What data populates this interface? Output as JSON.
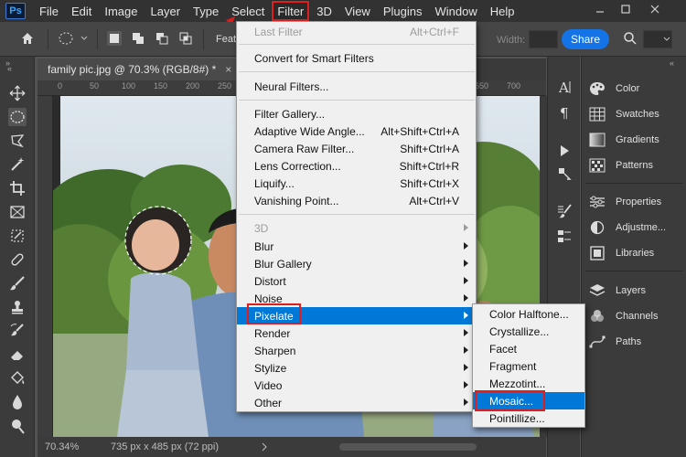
{
  "app": {
    "logo": "Ps"
  },
  "menubar": {
    "items": [
      "File",
      "Edit",
      "Image",
      "Layer",
      "Type",
      "Select",
      "Filter",
      "3D",
      "View",
      "Plugins",
      "Window",
      "Help"
    ],
    "active": "Filter",
    "window_controls": [
      "minimize-icon",
      "restore-icon",
      "close-icon"
    ]
  },
  "options_bar": {
    "feather_label": "Feath",
    "width_label": "Width:",
    "share_label": "Share",
    "icons": [
      "home-icon",
      "ellipse-marquee-icon",
      "new-selection-icon",
      "add-selection-icon",
      "subtract-selection-icon",
      "intersect-selection-icon",
      "search-icon"
    ]
  },
  "document": {
    "tab_title": "family pic.jpg @ 70.3% (RGB/8#) *",
    "close_label": "×",
    "ruler_ticks": [
      "0",
      "50",
      "100",
      "150",
      "200",
      "250",
      "300",
      "350",
      "400",
      "450",
      "500",
      "550",
      "600",
      "650",
      "700"
    ],
    "zoom": "70.34%",
    "doc_info": "735 px x 485 px (72 ppi)"
  },
  "filter_menu": {
    "items": [
      {
        "label": "Last Filter",
        "shortcut": "Alt+Ctrl+F",
        "disabled": true
      },
      {
        "label": "Convert for Smart Filters"
      },
      {
        "label": "Neural Filters..."
      },
      {
        "label": "Filter Gallery..."
      },
      {
        "label": "Adaptive Wide Angle...",
        "shortcut": "Alt+Shift+Ctrl+A"
      },
      {
        "label": "Camera Raw Filter...",
        "shortcut": "Shift+Ctrl+A"
      },
      {
        "label": "Lens Correction...",
        "shortcut": "Shift+Ctrl+R"
      },
      {
        "label": "Liquify...",
        "shortcut": "Shift+Ctrl+X"
      },
      {
        "label": "Vanishing Point...",
        "shortcut": "Alt+Ctrl+V"
      },
      {
        "label": "3D",
        "submenu": true,
        "disabled": true
      },
      {
        "label": "Blur",
        "submenu": true
      },
      {
        "label": "Blur Gallery",
        "submenu": true
      },
      {
        "label": "Distort",
        "submenu": true
      },
      {
        "label": "Noise",
        "submenu": true
      },
      {
        "label": "Pixelate",
        "submenu": true,
        "highlighted": true
      },
      {
        "label": "Render",
        "submenu": true
      },
      {
        "label": "Sharpen",
        "submenu": true
      },
      {
        "label": "Stylize",
        "submenu": true
      },
      {
        "label": "Video",
        "submenu": true
      },
      {
        "label": "Other",
        "submenu": true
      }
    ]
  },
  "pixelate_submenu": {
    "items": [
      {
        "label": "Color Halftone..."
      },
      {
        "label": "Crystallize..."
      },
      {
        "label": "Facet"
      },
      {
        "label": "Fragment"
      },
      {
        "label": "Mezzotint..."
      },
      {
        "label": "Mosaic...",
        "highlighted": true
      },
      {
        "label": "Pointillize..."
      }
    ]
  },
  "right_panels": {
    "group1": [
      {
        "label": "Color",
        "icon": "palette-icon"
      },
      {
        "label": "Swatches",
        "icon": "swatches-icon"
      },
      {
        "label": "Gradients",
        "icon": "gradient-icon"
      },
      {
        "label": "Patterns",
        "icon": "patterns-icon"
      }
    ],
    "group2": [
      {
        "label": "Properties",
        "icon": "properties-icon"
      },
      {
        "label": "Adjustme...",
        "icon": "adjustments-icon"
      },
      {
        "label": "Libraries",
        "icon": "libraries-icon"
      }
    ],
    "group3": [
      {
        "label": "Layers",
        "icon": "layers-icon"
      },
      {
        "label": "Channels",
        "icon": "channels-icon"
      },
      {
        "label": "Paths",
        "icon": "paths-icon"
      }
    ]
  },
  "colors": {
    "menu_highlight": "#0078d7",
    "annotation_red": "#e11c1c",
    "share_blue": "#1473e6"
  }
}
